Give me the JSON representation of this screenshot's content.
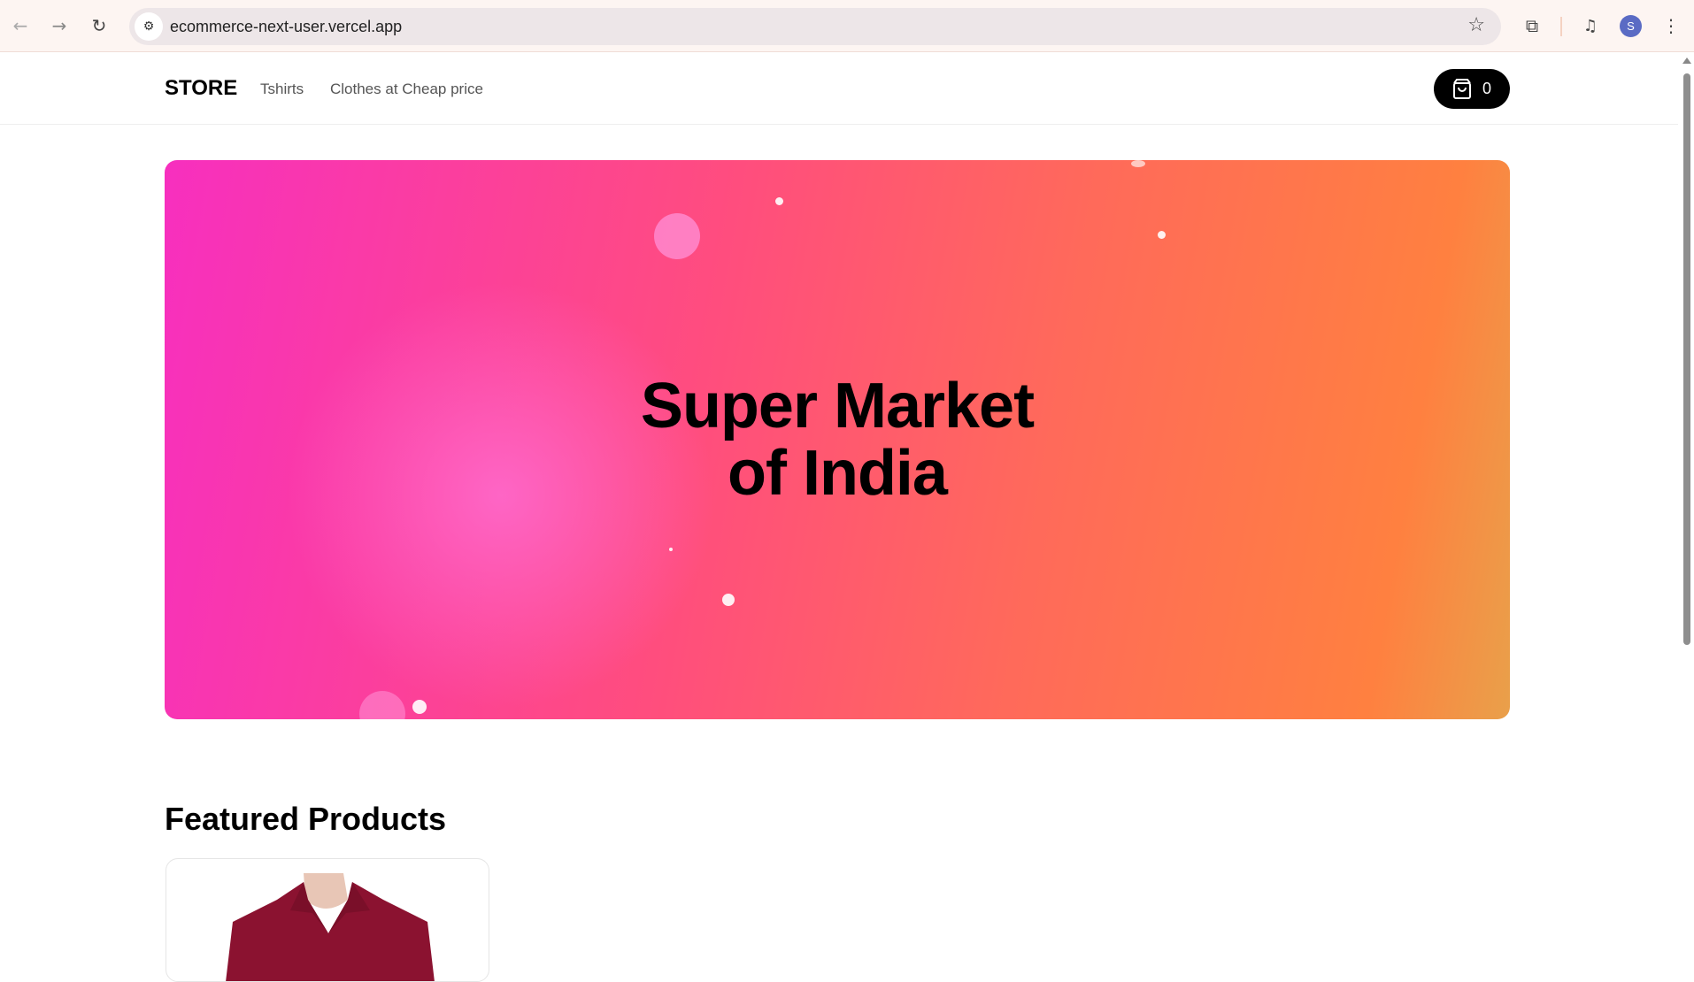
{
  "browser": {
    "url": "ecommerce-next-user.vercel.app",
    "profile_initial": "S"
  },
  "nav": {
    "logo": "STORE",
    "links": [
      "Tshirts",
      "Clothes at Cheap price"
    ],
    "cart_count": "0"
  },
  "hero": {
    "title": "Super Market of India"
  },
  "featured": {
    "heading": "Featured Products"
  },
  "colors": {
    "accent": "#000000",
    "hero_start": "#f72fbf",
    "hero_end": "#ff8040"
  }
}
